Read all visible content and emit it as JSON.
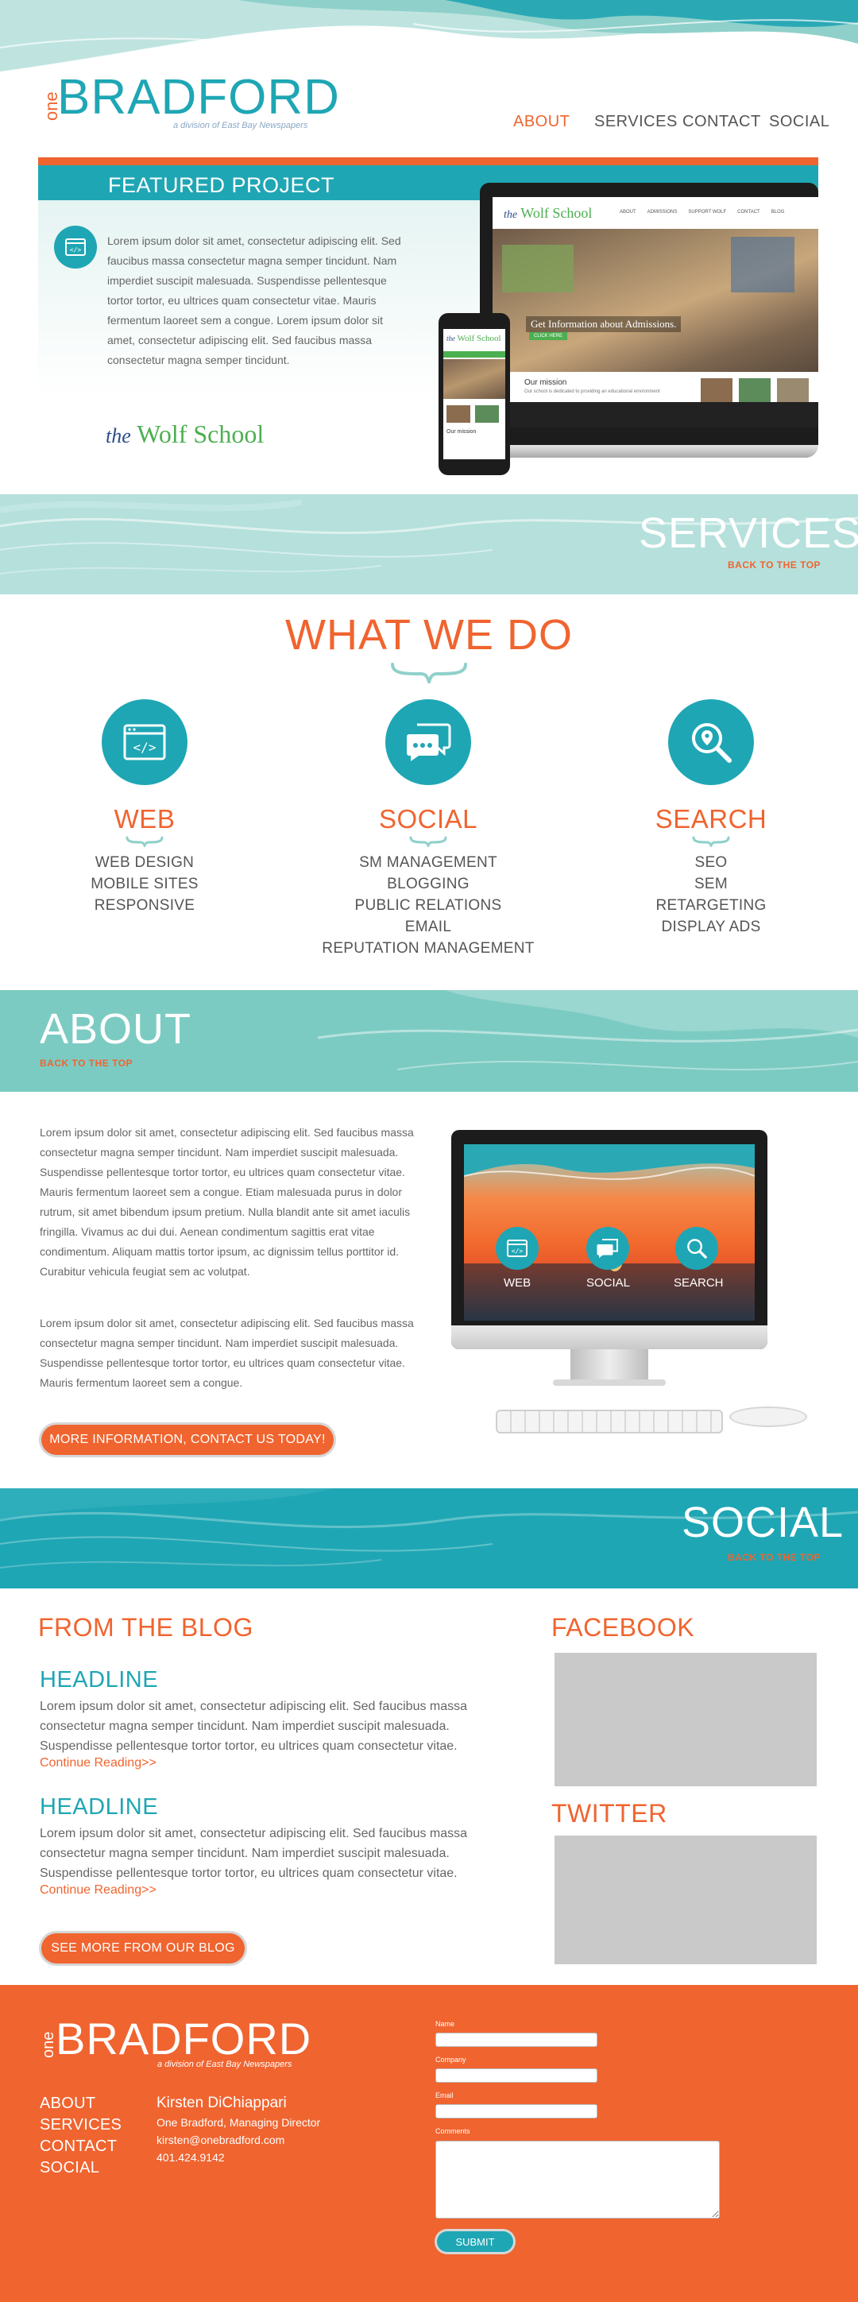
{
  "header": {
    "logo_prefix": "one",
    "logo_main": "BRADFORD",
    "logo_tagline": "a division of East Bay Newspapers",
    "nav": [
      "ABOUT",
      "SERVICES",
      "CONTACT",
      "SOCIAL"
    ],
    "active_nav": "ABOUT"
  },
  "featured": {
    "title": "FEATURED PROJECT",
    "description": "Lorem ipsum dolor sit amet, consectetur adipiscing elit. Sed faucibus massa consectetur magna semper tincidunt. Nam imperdiet suscipit malesuada. Suspendisse pellentesque tortor tortor, eu ultrices quam consectetur vitae. Mauris fermentum laoreet sem a congue. Lorem ipsum dolor sit amet, consectetur adipiscing elit. Sed faucibus massa consectetur magna semper tincidunt.",
    "client_prefix": "the",
    "client_name": "Wolf School",
    "mockup": {
      "site_name_prefix": "the",
      "site_name": "Wolf School",
      "site_nav": [
        "ABOUT",
        "ADMISSIONS",
        "SUPPORT WOLF",
        "CONTACT",
        "BLOG"
      ],
      "hero_text": "Get Information about Admissions.",
      "hero_button": "CLICK HERE",
      "mission_heading": "Our mission",
      "mission_text": "Our school is dedicated to providing an educational environment",
      "phone_mission": "Our mission"
    }
  },
  "services_band": {
    "title": "SERVICES",
    "back_link": "BACK TO THE TOP"
  },
  "what_we_do": {
    "title": "WHAT WE DO",
    "columns": [
      {
        "title": "WEB",
        "icon": "code-window-icon",
        "items": [
          "WEB DESIGN",
          "MOBILE SITES",
          "RESPONSIVE"
        ]
      },
      {
        "title": "SOCIAL",
        "icon": "chat-bubbles-icon",
        "items": [
          "SM MANAGEMENT",
          "BLOGGING",
          "PUBLIC RELATIONS",
          "EMAIL",
          "REPUTATION MANAGEMENT"
        ]
      },
      {
        "title": "SEARCH",
        "icon": "magnifier-icon",
        "items": [
          "SEO",
          "SEM",
          "RETARGETING",
          "DISPLAY ADS"
        ]
      }
    ]
  },
  "about_band": {
    "title": "ABOUT",
    "back_link": "BACK TO THE TOP"
  },
  "about": {
    "paragraph_1": "Lorem ipsum dolor sit amet, consectetur adipiscing elit. Sed faucibus massa consectetur magna semper tincidunt. Nam imperdiet suscipit malesuada. Suspendisse pellentesque tortor tortor, eu ultrices quam consectetur vitae. Mauris fermentum laoreet sem a congue. Etiam malesuada purus in dolor rutrum, sit amet bibendum ipsum pretium. Nulla blandit ante sit amet iaculis fringilla. Vivamus ac dui dui. Aenean condimentum sagittis erat vitae condimentum. Aliquam mattis tortor ipsum, ac dignissim tellus porttitor id. Curabitur vehicula feugiat sem ac volutpat.",
    "paragraph_2": "Lorem ipsum dolor sit amet, consectetur adipiscing elit. Sed faucibus massa consectetur magna semper tincidunt. Nam imperdiet suscipit malesuada. Suspendisse pellentesque tortor tortor, eu ultrices quam consectetur vitae. Mauris fermentum laoreet sem a congue.",
    "cta": "MORE INFORMATION, CONTACT US TODAY!",
    "monitor_labels": [
      "WEB",
      "SOCIAL",
      "SEARCH"
    ]
  },
  "social_band": {
    "title": "SOCIAL",
    "back_link": "BACK TO THE TOP"
  },
  "social": {
    "blog_title": "FROM THE BLOG",
    "posts": [
      {
        "headline": "HEADLINE",
        "text": "Lorem ipsum dolor sit amet, consectetur adipiscing elit. Sed faucibus massa consectetur magna semper tincidunt. Nam imperdiet suscipit malesuada. Suspendisse pellentesque tortor tortor, eu ultrices quam consectetur vitae.",
        "link": "Continue Reading>>"
      },
      {
        "headline": "HEADLINE",
        "text": "Lorem ipsum dolor sit amet, consectetur adipiscing elit. Sed faucibus massa consectetur magna semper tincidunt. Nam imperdiet suscipit malesuada. Suspendisse pellentesque tortor tortor, eu ultrices quam consectetur vitae.",
        "link": "Continue Reading>>"
      }
    ],
    "blog_button": "SEE MORE FROM OUR BLOG",
    "facebook_title": "FACEBOOK",
    "twitter_title": "TWITTER"
  },
  "footer": {
    "logo_prefix": "one",
    "logo_main": "BRADFORD",
    "logo_tagline": "a division of East Bay Newspapers",
    "nav": [
      "ABOUT",
      "SERVICES",
      "CONTACT",
      "SOCIAL"
    ],
    "contact_name": "Kirsten DiChiappari",
    "contact_title": "One Bradford, Managing Director",
    "contact_email": "kirsten@onebradford.com",
    "contact_phone": "401.424.9142",
    "form": {
      "name_label": "Name",
      "company_label": "Company",
      "email_label": "Email",
      "comments_label": "Comments",
      "submit": "SUBMIT"
    }
  },
  "colors": {
    "teal": "#1fa6b4",
    "light_teal": "#b5e0dc",
    "orange": "#f0642f",
    "gray_box": "#c9c9c9"
  }
}
